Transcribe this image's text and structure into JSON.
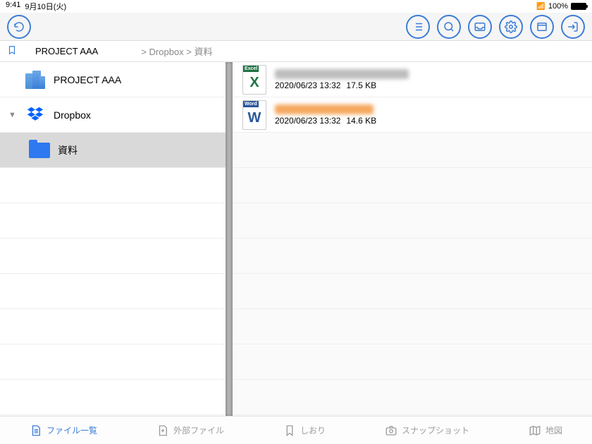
{
  "status": {
    "time": "9:41",
    "date": "9月10日(火)",
    "battery": "100%"
  },
  "breadcrumb": {
    "root": "PROJECT AAA",
    "path": "> Dropbox > 資料"
  },
  "sidebar": {
    "items": [
      {
        "label": "PROJECT AAA",
        "icon": "building",
        "chevron": ""
      },
      {
        "label": "Dropbox",
        "icon": "dropbox",
        "chevron": "▼"
      },
      {
        "label": "資料",
        "icon": "folder",
        "chevron": "",
        "nested": true,
        "selected": true
      }
    ]
  },
  "files": [
    {
      "type": "excel",
      "badge": "Excel",
      "letter": "X",
      "date": "2020/06/23 13:32",
      "size": "17.5 KB",
      "blur": "gray"
    },
    {
      "type": "word",
      "badge": "Word",
      "letter": "W",
      "date": "2020/06/23 13:32",
      "size": "14.6 KB",
      "blur": "orange"
    }
  ],
  "tabs": [
    {
      "label": "ファイル一覧",
      "icon": "file",
      "active": true
    },
    {
      "label": "外部ファイル",
      "icon": "external",
      "active": false
    },
    {
      "label": "しおり",
      "icon": "bookmark",
      "active": false
    },
    {
      "label": "スナップショット",
      "icon": "snapshot",
      "active": false
    },
    {
      "label": "地図",
      "icon": "map",
      "active": false
    }
  ]
}
